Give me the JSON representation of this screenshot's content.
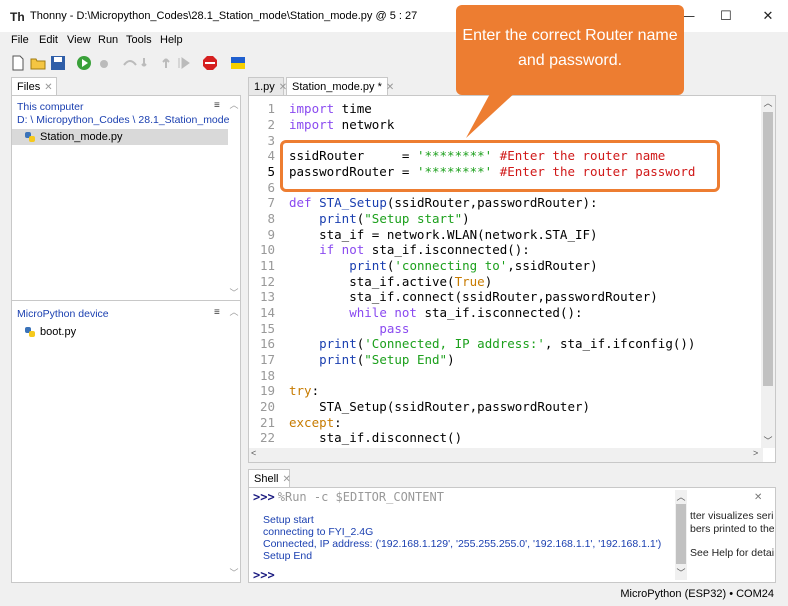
{
  "window": {
    "title": "Thonny  -  D:\\Micropython_Codes\\28.1_Station_mode\\Station_mode.py  @  5 : 27",
    "minimize": "—",
    "maximize": "☐",
    "close": "✕"
  },
  "menu": [
    "File",
    "Edit",
    "View",
    "Run",
    "Tools",
    "Help"
  ],
  "files_panel": {
    "tab": "Files",
    "computer_title": "This computer",
    "computer_path": "D: \\ Micropython_Codes \\ 28.1_Station_mode",
    "computer_files": [
      "Station_mode.py"
    ],
    "device_title": "MicroPython device",
    "device_files": [
      "boot.py"
    ]
  },
  "editor": {
    "tabs": [
      "1.py",
      "Station_mode.py *"
    ],
    "line_numbers": [
      "1",
      "2",
      "3",
      "4",
      "5",
      "6",
      "7",
      "8",
      "9",
      "10",
      "11",
      "12",
      "13",
      "14",
      "15",
      "16",
      "17",
      "18",
      "19",
      "20",
      "21",
      "22"
    ]
  },
  "shell": {
    "tab": "Shell",
    "prompt": ">>>",
    "run_command": "%Run -c $EDITOR_CONTENT",
    "output": [
      "Setup start",
      "connecting to FYI_2.4G",
      "Connected, IP address: ('192.168.1.129', '255.255.255.0', '192.168.1.1', '192.168.1.1')",
      "Setup End"
    ],
    "prompt2": ">>>"
  },
  "assistant_snippet": [
    "tter visualizes series",
    "bers printed to the",
    "",
    "See Help for details"
  ],
  "status": "MicroPython (ESP32)  •  COM24",
  "callout": "Enter the correct Router name and password.",
  "colors": {
    "accent": "#ed7d31",
    "keyword": "#8a4af0",
    "string": "#1ca01c",
    "comment": "#d01818"
  }
}
